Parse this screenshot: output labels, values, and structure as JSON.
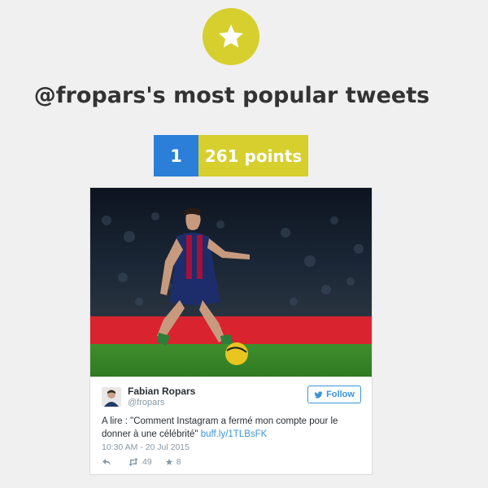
{
  "header": {
    "badge_icon": "star-icon",
    "title": "@fropars's most popular tweets"
  },
  "score": {
    "rank": "1",
    "points": "261 points"
  },
  "tweet": {
    "author_name": "Fabian Ropars",
    "author_handle": "@fropars",
    "follow_label": "Follow",
    "text": "A lire : \"Comment Instagram a fermé mon compte pour le donner à une célébrité\" ",
    "link_text": "buff.ly/1TLBsFK",
    "timestamp": "10:30 AM - 20 Jul 2015",
    "retweets": "49",
    "favorites": "8"
  },
  "colors": {
    "accent_yellow": "#d6cf2e",
    "rank_blue": "#2b7fd8",
    "twitter_blue": "#3b94d9"
  }
}
